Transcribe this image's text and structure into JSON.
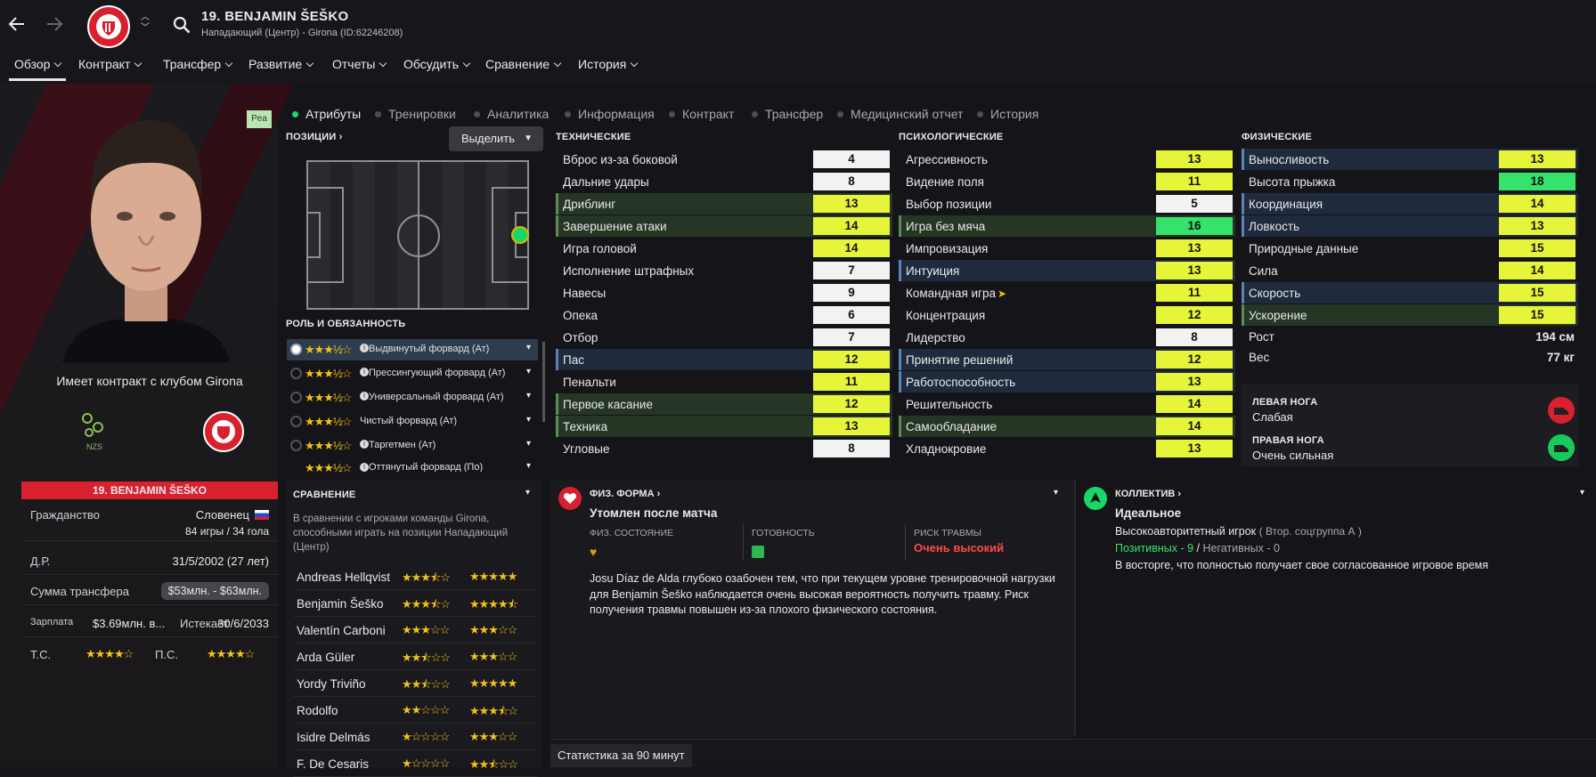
{
  "header": {
    "title": "19. BENJAMIN ŠEŠKO",
    "subtitle": "Нападающий (Центр) - Girona (ID:62246208)"
  },
  "nav": [
    "Обзор",
    "Контракт",
    "Трансфер",
    "Развитие",
    "Отчеты",
    "Обсудить",
    "Сравнение",
    "История"
  ],
  "subtabs": [
    "Атрибуты",
    "Тренировки",
    "Аналитика",
    "Информация",
    "Контракт",
    "Трансфер",
    "Медицинский отчет",
    "История"
  ],
  "badge": "Pea",
  "left": {
    "contract_text": "Имеет контракт с клубом Girona",
    "club_logo_text": "NZS",
    "card_name": "19. BENJAMIN ŠEŠKO",
    "citizenship_label": "Гражданство",
    "citizenship_value": "Словенец",
    "games": "84 игры / 34 гола",
    "dob_label": "Д.Р.",
    "dob_value": "31/5/2002 (27 лет)",
    "transfer_label": "Сумма трансфера",
    "transfer_value": "$53млн. - $63млн.",
    "wage_label": "Зарплата",
    "wage_value": "$3.69млн. в...",
    "expires_label": "Истекает",
    "expires_value": "30/6/2033",
    "ts_label": "Т.С.",
    "ps_label": "П.С."
  },
  "positions": {
    "title": "ПОЗИЦИИ",
    "select": "Выделить"
  },
  "roles": {
    "title": "РОЛЬ И ОБЯЗАННОСТЬ",
    "items": [
      "Выдвинутый форвард (Ат)",
      "Прессингующий форвард (Ат)",
      "Универсальный форвард (Ат)",
      "Чистый форвард (Ат)",
      "Таргетмен (Ат)",
      "Оттянутый форвард (По)"
    ]
  },
  "technical": {
    "title": "ТЕХНИЧЕСКИЕ",
    "items": [
      {
        "name": "Вброс из-за боковой",
        "value": "4",
        "style": "w",
        "hl": ""
      },
      {
        "name": "Дальние удары",
        "value": "8",
        "style": "w",
        "hl": ""
      },
      {
        "name": "Дриблинг",
        "value": "13",
        "style": "y",
        "hl": "g"
      },
      {
        "name": "Завершение атаки",
        "value": "14",
        "style": "y",
        "hl": "g"
      },
      {
        "name": "Игра головой",
        "value": "14",
        "style": "y",
        "hl": ""
      },
      {
        "name": "Исполнение штрафных",
        "value": "7",
        "style": "w",
        "hl": ""
      },
      {
        "name": "Навесы",
        "value": "9",
        "style": "w",
        "hl": ""
      },
      {
        "name": "Опека",
        "value": "6",
        "style": "w",
        "hl": ""
      },
      {
        "name": "Отбор",
        "value": "7",
        "style": "w",
        "hl": ""
      },
      {
        "name": "Пас",
        "value": "12",
        "style": "y",
        "hl": "b"
      },
      {
        "name": "Пенальти",
        "value": "11",
        "style": "y",
        "hl": ""
      },
      {
        "name": "Первое касание",
        "value": "12",
        "style": "y",
        "hl": "g"
      },
      {
        "name": "Техника",
        "value": "13",
        "style": "y",
        "hl": "g"
      },
      {
        "name": "Угловые",
        "value": "8",
        "style": "w",
        "hl": ""
      }
    ]
  },
  "mental": {
    "title": "ПСИХОЛОГИЧЕСКИЕ",
    "items": [
      {
        "name": "Агрессивность",
        "value": "13",
        "style": "y",
        "hl": ""
      },
      {
        "name": "Видение поля",
        "value": "11",
        "style": "y",
        "hl": ""
      },
      {
        "name": "Выбор позиции",
        "value": "5",
        "style": "w",
        "hl": ""
      },
      {
        "name": "Игра без мяча",
        "value": "16",
        "style": "gr",
        "hl": "g"
      },
      {
        "name": "Импровизация",
        "value": "13",
        "style": "y",
        "hl": ""
      },
      {
        "name": "Интуиция",
        "value": "13",
        "style": "y",
        "hl": "b"
      },
      {
        "name": "Командная игра",
        "value": "11",
        "style": "y",
        "hl": ""
      },
      {
        "name": "Концентрация",
        "value": "12",
        "style": "y",
        "hl": ""
      },
      {
        "name": "Лидерство",
        "value": "8",
        "style": "w",
        "hl": ""
      },
      {
        "name": "Принятие решений",
        "value": "12",
        "style": "y",
        "hl": "b"
      },
      {
        "name": "Работоспособность",
        "value": "13",
        "style": "y",
        "hl": "b"
      },
      {
        "name": "Решительность",
        "value": "14",
        "style": "y",
        "hl": ""
      },
      {
        "name": "Самообладание",
        "value": "14",
        "style": "y",
        "hl": "g"
      },
      {
        "name": "Хладнокровие",
        "value": "13",
        "style": "y",
        "hl": ""
      }
    ]
  },
  "physical": {
    "title": "ФИЗИЧЕСКИЕ",
    "items": [
      {
        "name": "Выносливость",
        "value": "13",
        "style": "y",
        "hl": "b"
      },
      {
        "name": "Высота прыжка",
        "value": "18",
        "style": "gr",
        "hl": ""
      },
      {
        "name": "Координация",
        "value": "14",
        "style": "y",
        "hl": "b"
      },
      {
        "name": "Ловкость",
        "value": "13",
        "style": "y",
        "hl": "b"
      },
      {
        "name": "Природные данные",
        "value": "15",
        "style": "y",
        "hl": ""
      },
      {
        "name": "Сила",
        "value": "14",
        "style": "y",
        "hl": ""
      },
      {
        "name": "Скорость",
        "value": "15",
        "style": "y",
        "hl": "b"
      },
      {
        "name": "Ускорение",
        "value": "15",
        "style": "y",
        "hl": "g"
      }
    ],
    "height_label": "Рост",
    "height_value": "194 см",
    "weight_label": "Вес",
    "weight_value": "77 кг",
    "left_foot_label": "ЛЕВАЯ НОГА",
    "left_foot_value": "Слабая",
    "right_foot_label": "ПРАВАЯ НОГА",
    "right_foot_value": "Очень сильная"
  },
  "comparison": {
    "title": "СРАВНЕНИЕ",
    "desc": "В сравнении с игроками команды Girona, способными играть на позиции Нападающий (Центр)",
    "players": [
      {
        "name": "Andreas Hellqvist",
        "s1": 3.5,
        "s2": 5
      },
      {
        "name": "Benjamin Šeško",
        "s1": 3.5,
        "s2": 4.5
      },
      {
        "name": "Valentín Carboni",
        "s1": 3,
        "s2": 3
      },
      {
        "name": "Arda Güler",
        "s1": 2.5,
        "s2": 3
      },
      {
        "name": "Yordy Triviño",
        "s1": 2.5,
        "s2": 5
      },
      {
        "name": "Rodolfo",
        "s1": 2,
        "s2": 3.5
      },
      {
        "name": "Isidre Delmás",
        "s1": 1,
        "s2": 3
      },
      {
        "name": "F. De Cesaris",
        "s1": 1,
        "s2": 2.5
      }
    ]
  },
  "fitness": {
    "title": "ФИЗ. ФОРМА",
    "status": "Утомлен после матча",
    "cond_label": "ФИЗ. СОСТОЯНИЕ",
    "ready_label": "ГОТОВНОСТЬ",
    "risk_label": "РИСК ТРАВМЫ",
    "risk_value": "Очень высокий",
    "note": "Josu Díaz de Alda глубоко озабочен тем, что при текущем уровне тренировочной нагрузки для Benjamin Šeško наблюдается очень высокая вероятность получить травму. Риск получения травмы повышен из-за плохого физического состояния."
  },
  "team": {
    "title": "КОЛЛЕКТИВ",
    "status": "Идеальное",
    "group": "Высокоавторитетный игрок",
    "group_sub": "( Втор. соцгруппа А )",
    "positive": "Позитивных - 9",
    "negative": "Негативных - 0",
    "note": "В восторге, что полностью получает свое согласованное игровое время"
  },
  "stats_tab": "Статистика за 90 минут",
  "colors": {
    "accent_yellow": "#e7f53a",
    "accent_green": "#35e36c",
    "accent_red": "#d8202f",
    "risk": "#ff4a4a"
  }
}
